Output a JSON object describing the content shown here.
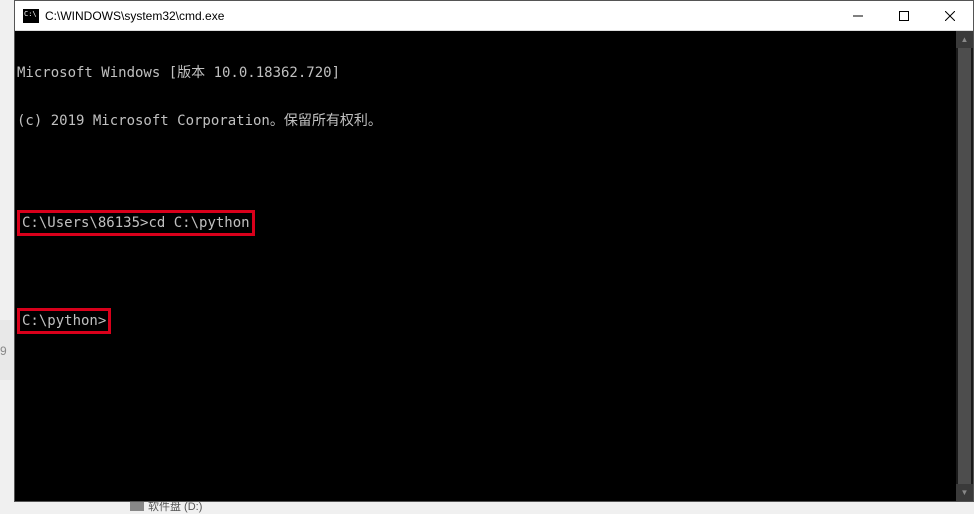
{
  "title": "C:\\WINDOWS\\system32\\cmd.exe",
  "header": {
    "line1": "Microsoft Windows [版本 10.0.18362.720]",
    "line2": "(c) 2019 Microsoft Corporation。保留所有权利。"
  },
  "cmd1": {
    "prompt": "C:\\Users\\86135>",
    "command": "cd C:\\python"
  },
  "cmd2": {
    "prompt": "C:\\python>"
  },
  "bg": {
    "label": "9",
    "taskbar": "软件盘 (D:)"
  }
}
